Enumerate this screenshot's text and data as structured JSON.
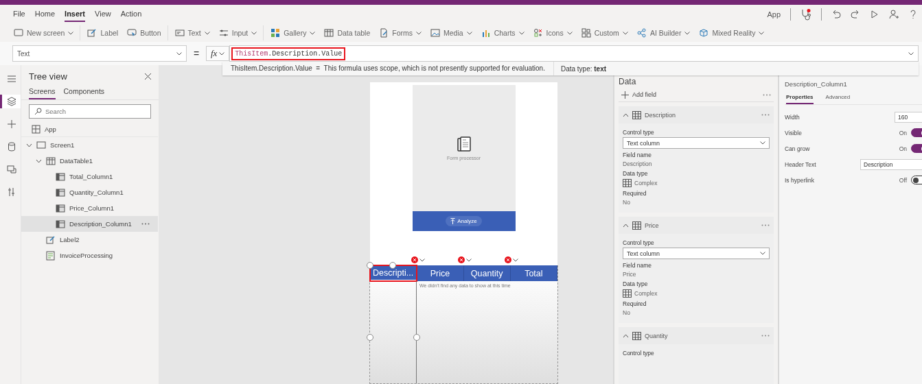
{
  "menu": [
    {
      "label": "File",
      "selected": false
    },
    {
      "label": "Home",
      "selected": false
    },
    {
      "label": "Insert",
      "selected": true
    },
    {
      "label": "View",
      "selected": false
    },
    {
      "label": "Action",
      "selected": false
    }
  ],
  "header": {
    "app_label": "App",
    "alert": true
  },
  "toolbar": [
    {
      "label": "New screen",
      "dropdown": true
    },
    {
      "label": "Label",
      "dropdown": false
    },
    {
      "label": "Button",
      "dropdown": false
    },
    {
      "label": "Text",
      "dropdown": true
    },
    {
      "label": "Input",
      "dropdown": true
    },
    {
      "label": "Gallery",
      "dropdown": true
    },
    {
      "label": "Data table",
      "dropdown": false
    },
    {
      "label": "Forms",
      "dropdown": true
    },
    {
      "label": "Media",
      "dropdown": true
    },
    {
      "label": "Charts",
      "dropdown": true
    },
    {
      "label": "Icons",
      "dropdown": true
    },
    {
      "label": "Custom",
      "dropdown": true
    },
    {
      "label": "AI Builder",
      "dropdown": true
    },
    {
      "label": "Mixed Reality",
      "dropdown": true
    }
  ],
  "formula_bar": {
    "property": "Text",
    "equals": "=",
    "fx": "fx",
    "highlighted": true,
    "formula": [
      {
        "text": "ThisItem",
        "kind": "keyword"
      },
      {
        "text": ".Description.Value",
        "kind": "plain"
      }
    ]
  },
  "formula_hint": {
    "expression": "ThisItem.Description.Value",
    "separator": "=",
    "message": "This formula uses scope, which is not presently supported for evaluation.",
    "data_type": "Data type: **text**"
  },
  "rail": [
    {
      "selected": false
    },
    {
      "selected": true
    },
    {
      "selected": false
    },
    {
      "selected": false
    },
    {
      "selected": false
    },
    {
      "selected": false
    }
  ],
  "tree_view": {
    "title": "Tree view",
    "tabs": [
      {
        "label": "Screens",
        "selected": true
      },
      {
        "label": "Components",
        "selected": false
      }
    ],
    "search": {
      "placeholder": "Search"
    },
    "app": "App",
    "nodes": [
      {
        "label": "Screen1",
        "kind": "screen",
        "selected": false,
        "expanded": true,
        "children": [
          {
            "label": "DataTable1",
            "kind": "table",
            "selected": false,
            "expanded": true,
            "children": [
              {
                "label": "Total_Column1",
                "kind": "column",
                "selected": false
              },
              {
                "label": "Quantity_Column1",
                "kind": "column",
                "selected": false
              },
              {
                "label": "Price_Column1",
                "kind": "column",
                "selected": false
              },
              {
                "label": "Description_Column1",
                "kind": "column",
                "selected": true
              }
            ]
          },
          {
            "label": "Label2",
            "kind": "label",
            "selected": false
          },
          {
            "label": "InvoiceProcessing",
            "kind": "form",
            "selected": false
          }
        ]
      }
    ]
  },
  "canvas": {
    "form_caption": "Form processor",
    "analyze_button": "Analyze",
    "table": {
      "columns": [
        {
          "header": "Descripti...",
          "selected": true
        },
        {
          "header": "Price",
          "selected": false
        },
        {
          "header": "Quantity",
          "selected": false
        },
        {
          "header": "Total",
          "selected": false
        }
      ],
      "empty_message": "We didn't find any data to show at this time"
    }
  },
  "data_panel": {
    "title": "Data",
    "add_field": "Add field",
    "fields": [
      {
        "name": "Description",
        "expanded": true,
        "control_type_label": "Control type",
        "control_type": "Text column",
        "field_name_label": "Field name",
        "field_name": "Description",
        "data_type_label": "Data type",
        "data_type": "Complex",
        "required_label": "Required",
        "required": "No"
      },
      {
        "name": "Price",
        "expanded": true,
        "control_type_label": "Control type",
        "control_type": "Text column",
        "field_name_label": "Field name",
        "field_name": "Price",
        "data_type_label": "Data type",
        "data_type": "Complex",
        "required_label": "Required",
        "required": "No"
      },
      {
        "name": "Quantity",
        "expanded": true,
        "control_type_label": "Control type"
      }
    ]
  },
  "properties_panel": {
    "name": "Description_Column1",
    "tabs": [
      {
        "label": "Properties",
        "selected": true
      },
      {
        "label": "Advanced",
        "selected": false
      }
    ],
    "props": [
      {
        "label": "Width",
        "kind": "input",
        "value": "160"
      },
      {
        "label": "Visible",
        "kind": "toggle",
        "on": true,
        "state_text": "On"
      },
      {
        "label": "Can grow",
        "kind": "toggle",
        "on": true,
        "state_text": "On"
      },
      {
        "label": "Header Text",
        "kind": "input",
        "value": "Description"
      },
      {
        "label": "Is hyperlink",
        "kind": "toggle",
        "on": false,
        "state_text": "Off"
      }
    ]
  }
}
